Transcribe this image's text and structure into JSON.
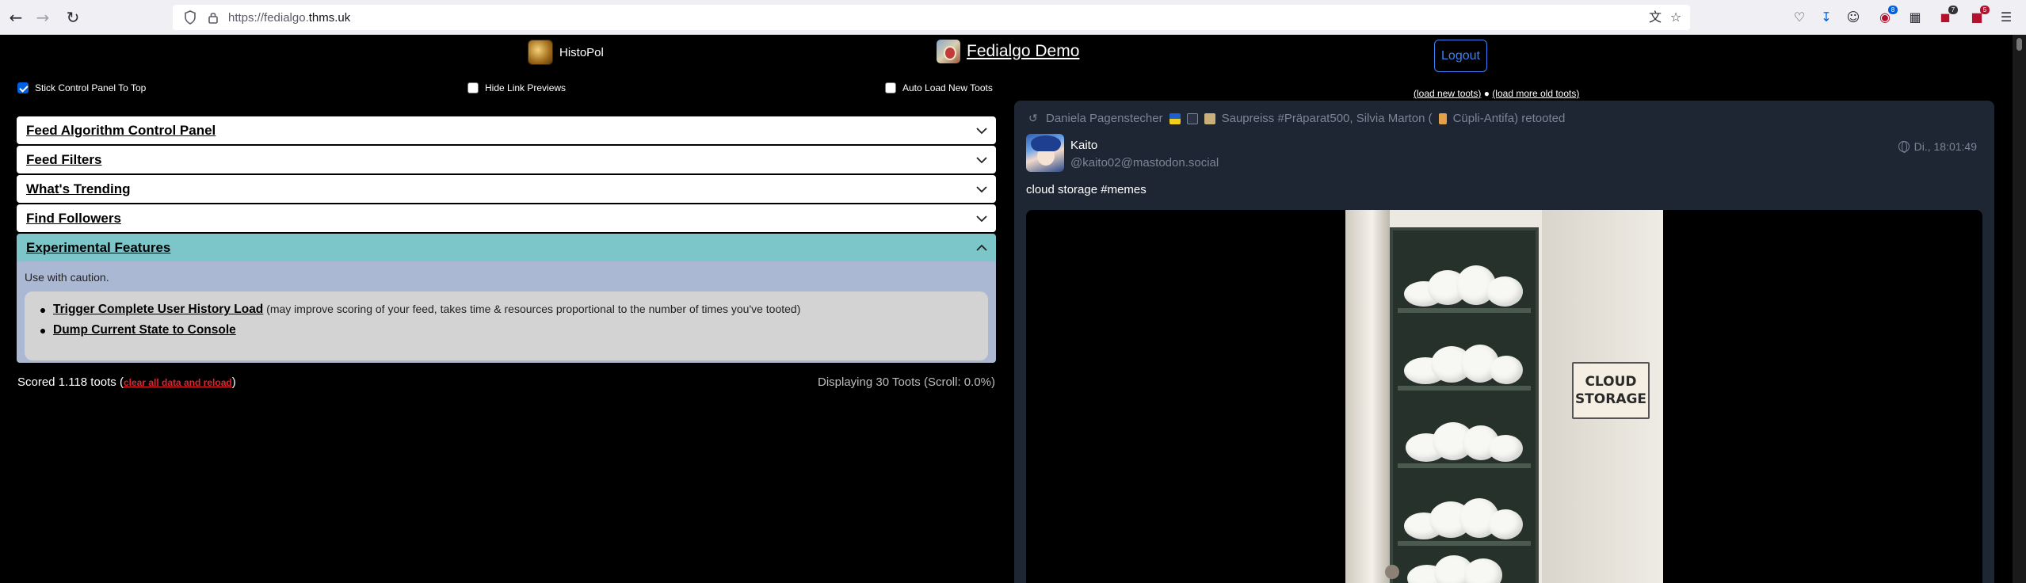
{
  "browser": {
    "url_prefix": "https://fedialgo.",
    "url_domain": "thms.uk",
    "badges": {
      "extension_blue": "8",
      "extension_red_a": "7",
      "extension_red_b": "5"
    }
  },
  "header": {
    "histopol_label": "HistoPol",
    "app_title": "Fedialgo Demo",
    "logout_label": "Logout"
  },
  "options": {
    "stick_panel": "Stick Control Panel To Top",
    "hide_link_previews": "Hide Link Previews",
    "auto_load": "Auto Load New Toots"
  },
  "panels": {
    "p0": "Feed Algorithm Control Panel",
    "p1": "Feed Filters",
    "p2": "What's Trending",
    "p3": "Find Followers",
    "p4": "Experimental Features"
  },
  "experimental": {
    "intro": "Use with caution.",
    "trigger_label": "Trigger Complete User History Load",
    "trigger_note": " (may improve scoring of your feed, takes time & resources proportional to the number of times you've tooted)",
    "dump_label": "Dump Current State to Console"
  },
  "status": {
    "scored_prefix": "Scored 1.118 toots (",
    "clear_label": "clear all data and reload",
    "scored_suffix": ")",
    "displaying": "Displaying 30 Toots (Scroll: 0.0%)"
  },
  "feed": {
    "load_new": "(load new toots)",
    "separator": " ● ",
    "load_more": "(load more old toots)"
  },
  "toot": {
    "retooters_a": "Daniela Pagenstecher",
    "retooters_b": "Saupreiss #Präparat500, Silvia Marton (",
    "retooters_c": "Cüpli-Antifa) retooted",
    "author_name": "Kaito",
    "author_handle": "@kaito02@mastodon.social",
    "time": "Di., 18:01:49",
    "content": "cloud storage #memes",
    "sign_line1": "CLOUD",
    "sign_line2": "STORAGE"
  },
  "colors": {
    "accent_blue": "#3b82f6",
    "experimental_header": "#7cc5c8",
    "experimental_body": "#aab8d4",
    "clear_link_red": "#e8202a",
    "toot_bg": "#1f2633"
  }
}
